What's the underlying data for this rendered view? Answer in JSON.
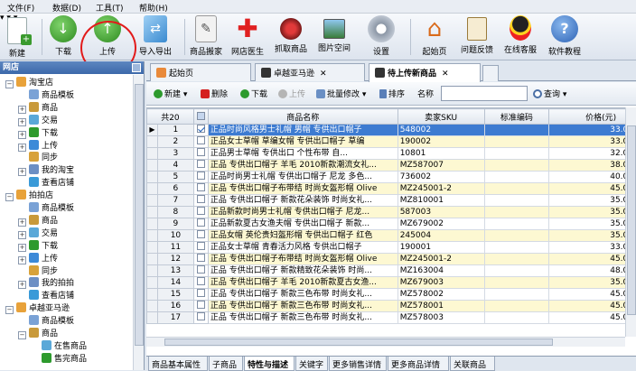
{
  "menu": [
    "文件(F)",
    "数据(D)",
    "工具(T)",
    "帮助(H)"
  ],
  "toolbar": {
    "new": "新建",
    "download": "下载",
    "upload": "上传",
    "import_export": "导入导出",
    "product_move": "商品搬家",
    "shop_doctor": "网店医生",
    "grab_product": "抓取商品",
    "image_space": "图片空间",
    "settings": "设置",
    "start_page": "起始页",
    "feedback": "问题反馈",
    "online_service": "在线客服",
    "tutorial": "软件教程"
  },
  "left_panel": {
    "title": "网店",
    "tree": [
      {
        "label": "淘宝店",
        "level": 0,
        "toggle": "−"
      },
      {
        "label": "商品模板",
        "level": 1,
        "toggle": ""
      },
      {
        "label": "商品",
        "level": 1,
        "toggle": "+"
      },
      {
        "label": "交易",
        "level": 1,
        "toggle": "+"
      },
      {
        "label": "下载",
        "level": 1,
        "toggle": "+"
      },
      {
        "label": "上传",
        "level": 1,
        "toggle": "+"
      },
      {
        "label": "同步",
        "level": 1,
        "toggle": ""
      },
      {
        "label": "我的淘宝",
        "level": 1,
        "toggle": "+"
      },
      {
        "label": "查看店铺",
        "level": 1,
        "toggle": ""
      },
      {
        "label": "拍拍店",
        "level": 0,
        "toggle": "−"
      },
      {
        "label": "商品模板",
        "level": 1,
        "toggle": ""
      },
      {
        "label": "商品",
        "level": 1,
        "toggle": "+"
      },
      {
        "label": "交易",
        "level": 1,
        "toggle": "+"
      },
      {
        "label": "下载",
        "level": 1,
        "toggle": "+"
      },
      {
        "label": "上传",
        "level": 1,
        "toggle": "+"
      },
      {
        "label": "同步",
        "level": 1,
        "toggle": ""
      },
      {
        "label": "我的拍拍",
        "level": 1,
        "toggle": "+"
      },
      {
        "label": "查看店铺",
        "level": 1,
        "toggle": ""
      },
      {
        "label": "卓越亚马逊",
        "level": 0,
        "toggle": "−"
      },
      {
        "label": "商品模板",
        "level": 1,
        "toggle": ""
      },
      {
        "label": "商品",
        "level": 1,
        "toggle": "−"
      },
      {
        "label": "在售商品",
        "level": 2,
        "toggle": ""
      },
      {
        "label": "售完商品",
        "level": 2,
        "toggle": ""
      }
    ]
  },
  "tabs": [
    {
      "label": "起始页",
      "close": ""
    },
    {
      "label": "卓越亚马逊",
      "close": "✕"
    },
    {
      "label": "待上传新商品",
      "close": "✕"
    }
  ],
  "sub_toolbar": {
    "new": "新建",
    "delete": "删除",
    "download": "下载",
    "upload": "上传",
    "batch_edit": "批量修改",
    "sort": "排序",
    "name_label": "名称",
    "name_value": "",
    "query": "查询"
  },
  "grid": {
    "count_label": "共20",
    "columns": [
      "",
      "商品名称",
      "卖家SKU",
      "标准编码",
      "价格(元)"
    ],
    "rows": [
      {
        "no": "1",
        "checked": true,
        "name": "正品时尚风格男士礼帽 男帽 专供出口帽子",
        "sku": "548002",
        "code": "",
        "price": "33.00"
      },
      {
        "no": "2",
        "checked": false,
        "name": "正品女士草帽 草编女帽 专供出口帽子 草编",
        "sku": "190002",
        "code": "",
        "price": "33.00"
      },
      {
        "no": "3",
        "checked": false,
        "name": "正品男士草帽 专供出口  个性布带 自...",
        "sku": "10801",
        "code": "",
        "price": "32.00"
      },
      {
        "no": "4",
        "checked": false,
        "name": "正品 专供出口帽子 羊毛 2010新款潮流女礼...",
        "sku": "MZ587007",
        "code": "",
        "price": "38.00"
      },
      {
        "no": "5",
        "checked": false,
        "name": "正品时尚男士礼帽 专供出口帽子 尼龙 多色...",
        "sku": "736002",
        "code": "",
        "price": "40.00"
      },
      {
        "no": "6",
        "checked": false,
        "name": "正品 专供出口帽子布带结 时尚女盔形帽 Olive",
        "sku": "MZ245001-2",
        "code": "",
        "price": "45.00"
      },
      {
        "no": "7",
        "checked": false,
        "name": "正品 专供出口帽子 新款花朵装饰 时尚女礼...",
        "sku": "MZ810001",
        "code": "",
        "price": "35.00"
      },
      {
        "no": "8",
        "checked": false,
        "name": "正品新款时尚男士礼帽 专供出口帽子 尼龙...",
        "sku": "587003",
        "code": "",
        "price": "35.00"
      },
      {
        "no": "9",
        "checked": false,
        "name": "正品新款夏古女渔夫帽 专供出口帽子 新款...",
        "sku": "MZ679002",
        "code": "",
        "price": "35.00"
      },
      {
        "no": "10",
        "checked": false,
        "name": "正品女帽 英伦贵妇盔形帽 专供出口帽子 红色",
        "sku": "245004",
        "code": "",
        "price": "35.00"
      },
      {
        "no": "11",
        "checked": false,
        "name": "正品女士草帽 青春活力风格 专供出口帽子",
        "sku": "190001",
        "code": "",
        "price": "33.00"
      },
      {
        "no": "12",
        "checked": false,
        "name": "正品 专供出口帽子布带结 时尚女盔形帽 Olive",
        "sku": "MZ245001-2",
        "code": "",
        "price": "45.00"
      },
      {
        "no": "13",
        "checked": false,
        "name": "正品 专供出口帽子 新款精致花朵装饰 时尚...",
        "sku": "MZ163004",
        "code": "",
        "price": "48.00"
      },
      {
        "no": "14",
        "checked": false,
        "name": "正品 专供出口帽子 羊毛 2010新款夏古女渔...",
        "sku": "MZ679003",
        "code": "",
        "price": "35.00"
      },
      {
        "no": "15",
        "checked": false,
        "name": "正品 专供出口帽子 新款三色布带 时尚女礼...",
        "sku": "MZ578002",
        "code": "",
        "price": "45.00"
      },
      {
        "no": "16",
        "checked": false,
        "name": "正品 专供出口帽子 新款三色布带 时尚女礼...",
        "sku": "MZ578001",
        "code": "",
        "price": "45.00"
      },
      {
        "no": "17",
        "checked": false,
        "name": "正品 专供出口帽子 新款三色布带 时尚女礼...",
        "sku": "MZ578003",
        "code": "",
        "price": "45.00"
      }
    ]
  },
  "bottom_tabs": [
    "商品基本属性",
    "子商品",
    "特性与描述",
    "关键字",
    "更多销售详情",
    "更多商品详情",
    "关联商品"
  ],
  "colors": {
    "accent": "#3d7bd1",
    "alt_row": "#fdf8d2",
    "highlight_circle": "#e21b1b"
  }
}
